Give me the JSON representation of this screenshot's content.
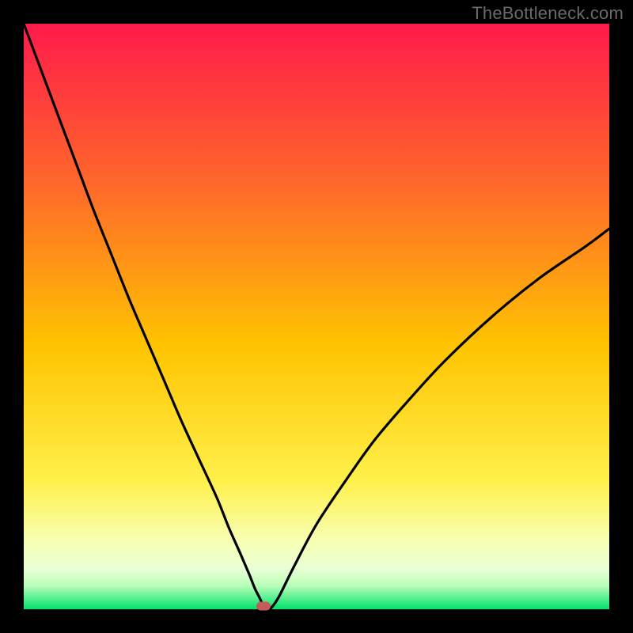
{
  "watermark": "TheBottleneck.com",
  "colors": {
    "frame": "#000000",
    "gradient_top": "#ff1a4b",
    "gradient_mid_upper": "#ff7a2a",
    "gradient_mid": "#ffd400",
    "gradient_lower": "#f6ff66",
    "gradient_pale": "#f4ffc8",
    "gradient_bottom": "#00e06a",
    "curve": "#000000",
    "marker": "#c55a5a"
  },
  "chart_data": {
    "type": "line",
    "title": "",
    "xlabel": "",
    "ylabel": "",
    "xlim": [
      0,
      100
    ],
    "ylim": [
      0,
      100
    ],
    "series": [
      {
        "name": "bottleneck-curve",
        "x": [
          0,
          3,
          6,
          9,
          12,
          15,
          18,
          21,
          24,
          27,
          30,
          33,
          35,
          37,
          38.5,
          39.5,
          40.5,
          41,
          42,
          43.5,
          46,
          50,
          55,
          60,
          66,
          72,
          80,
          88,
          96,
          100
        ],
        "values": [
          100,
          92,
          84,
          76,
          68,
          60.5,
          53,
          46,
          39,
          32,
          25.5,
          19,
          14,
          9.5,
          6,
          3.5,
          1.5,
          0,
          0,
          2,
          7,
          14.5,
          22,
          29,
          36,
          42.5,
          50,
          56.5,
          62,
          65
        ]
      }
    ],
    "marker": {
      "x": 41,
      "y": 0
    },
    "flat_bottom": {
      "x_start": 39.5,
      "x_end": 43.0,
      "y": 0
    }
  }
}
